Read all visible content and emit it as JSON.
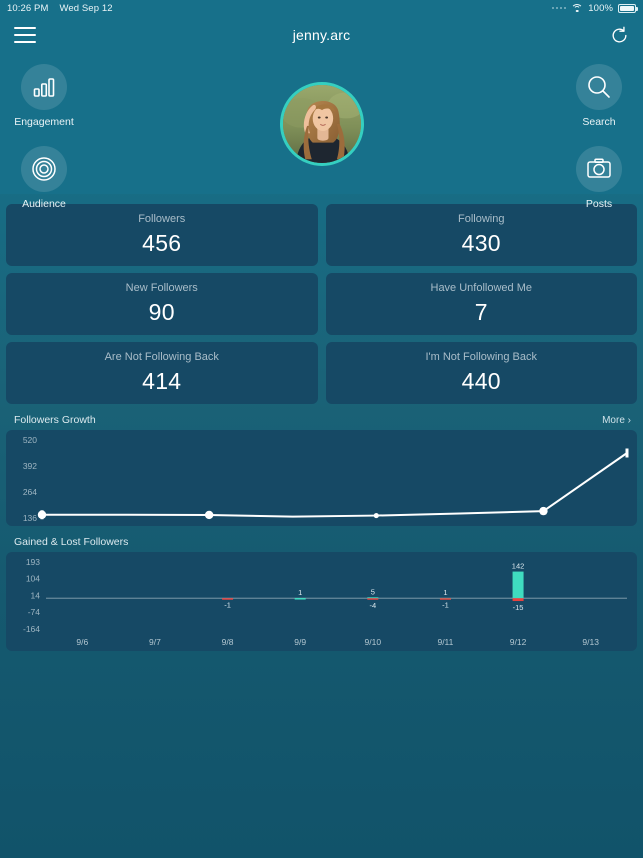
{
  "statusbar": {
    "time": "10:26 PM",
    "date": "Wed Sep 12",
    "battery_pct": "100%",
    "wifi_icon": "wifi-icon",
    "battery_icon": "battery-icon",
    "signal_icon": "signal-dots-icon"
  },
  "navbar": {
    "menu_icon": "hamburger-menu-icon",
    "title": "jenny.arc",
    "refresh_icon": "refresh-icon"
  },
  "quick_actions": [
    {
      "label": "Engagement",
      "icon": "bar-chart-icon"
    },
    {
      "label": "Audience",
      "icon": "concentric-circles-icon"
    },
    {
      "label": "Search",
      "icon": "search-icon"
    },
    {
      "label": "Posts",
      "icon": "camera-icon"
    }
  ],
  "profile": {
    "avatar_icon": "profile-avatar",
    "ring_color": "#35cfc0"
  },
  "stats": [
    {
      "label": "Followers",
      "value": "456"
    },
    {
      "label": "Following",
      "value": "430"
    },
    {
      "label": "New Followers",
      "value": "90"
    },
    {
      "label": "Have Unfollowed Me",
      "value": "7"
    },
    {
      "label": "Are Not Following Back",
      "value": "414"
    },
    {
      "label": "I'm Not Following Back",
      "value": "440"
    }
  ],
  "growth_panel": {
    "title": "Followers Growth",
    "more_label": "More ›"
  },
  "gained_lost_panel": {
    "title": "Gained & Lost Followers"
  },
  "colors": {
    "page_bg": "#17708a",
    "card_bg": "#164965",
    "accent_teal": "#3fdcc0",
    "accent_red": "#e8433f",
    "line": "#ffffff",
    "muted_text": "#a9bdc9"
  },
  "chart_data": [
    {
      "type": "line",
      "title": "Followers Growth",
      "xlabel": "",
      "ylabel": "",
      "ylim": [
        136,
        520
      ],
      "ytick_labels": [
        "520",
        "392",
        "264",
        "136"
      ],
      "ytick_values": [
        520,
        392,
        264,
        136
      ],
      "grid": false,
      "legend": "none",
      "x": [
        "9/6",
        "9/7",
        "9/8",
        "9/9",
        "9/10",
        "9/11",
        "9/12",
        "9/13"
      ],
      "values": [
        152,
        152,
        151,
        143,
        148,
        158,
        170,
        456
      ],
      "marker_points": [
        {
          "x": "9/6",
          "y": 152
        },
        {
          "x": "9/8",
          "y": 151
        },
        {
          "x": "9/10",
          "y": 143
        },
        {
          "x": "9/12",
          "y": 170
        },
        {
          "x": "9/13",
          "y": 456
        }
      ]
    },
    {
      "type": "bar",
      "title": "Gained & Lost Followers",
      "xlabel": "",
      "ylabel": "",
      "ylim": [
        -164,
        193
      ],
      "ytick_labels": [
        "193",
        "104",
        "14",
        "-74",
        "-164"
      ],
      "ytick_values": [
        193,
        104,
        14,
        -74,
        -164
      ],
      "grid": false,
      "legend": "none",
      "categories": [
        "9/6",
        "9/7",
        "9/8",
        "9/9",
        "9/10",
        "9/11",
        "9/12",
        "9/13"
      ],
      "series": [
        {
          "name": "Gained",
          "color": "#3fdcc0",
          "values": [
            0,
            0,
            0,
            1,
            5,
            1,
            142,
            0
          ]
        },
        {
          "name": "Lost",
          "color": "#e8433f",
          "values": [
            0,
            0,
            -1,
            0,
            -4,
            -1,
            -15,
            0
          ]
        }
      ],
      "gained_labels": [
        "",
        "",
        "",
        "1",
        "5",
        "1",
        "142",
        ""
      ],
      "lost_labels": [
        "",
        "",
        "-1",
        "",
        "-4",
        "-1",
        "-15",
        ""
      ]
    }
  ]
}
